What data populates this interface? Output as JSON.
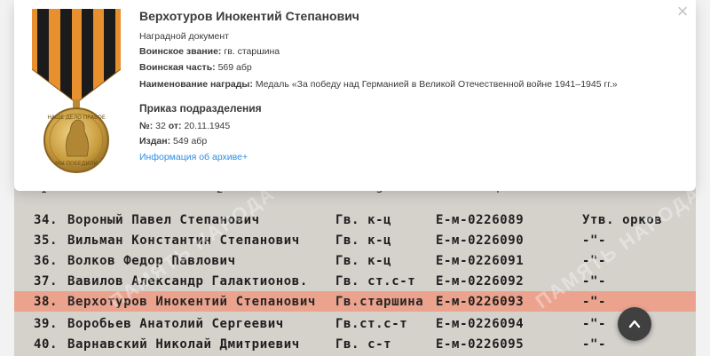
{
  "award": {
    "person_name": "Верхотуров Инокентий Степанович",
    "doc_type": "Наградной документ",
    "rank_label": "Воинское звание:",
    "rank_value": "гв. старшина",
    "unit_label": "Воинская часть:",
    "unit_value": "569 абр",
    "award_label": "Наименование награды:",
    "award_value": "Медаль «За победу над Германией в Великой Отечественной войне 1941–1945 гг.»"
  },
  "order": {
    "title": "Приказ подразделения",
    "number_label": "№:",
    "number_value": "32",
    "date_label": "от:",
    "date_value": "20.11.1945",
    "issued_label": "Издан:",
    "issued_value": "549 абр",
    "archive_link": "Информация об архиве+"
  },
  "medal_inscription_top": "НАШЕ ДЕЛО ПРАВОЕ",
  "medal_inscription_bottom": "МЫ ПОБЕДИЛИ",
  "scan": {
    "header_marks": [
      "I",
      "2",
      "3",
      "4"
    ],
    "rows": [
      {
        "num": "34.",
        "name": "Вороный Павел Степанович",
        "rank": "Гв. к-ц",
        "doc": "Е-м-0226089",
        "note": "Утв. орков"
      },
      {
        "num": "35.",
        "name": "Вильман Константин Степанович",
        "rank": "Гв. к-ц",
        "doc": "Е-м-0226090",
        "note": "-\"-"
      },
      {
        "num": "36.",
        "name": "Волков Федор Павлович",
        "rank": "Гв. к-ц",
        "doc": "Е-м-0226091",
        "note": "-\"-"
      },
      {
        "num": "37.",
        "name": "Вавилов Александр Галактионов.",
        "rank": "Гв. ст.с-т",
        "doc": "Е-м-0226092",
        "note": "-\"-"
      },
      {
        "num": "38.",
        "name": "Верхотуров Инокентий Степанович",
        "rank": "Гв.старшина",
        "doc": "Е-м-0226093",
        "note": "-\"-"
      },
      {
        "num": "39.",
        "name": "Воробьев Анатолий Сергеевич",
        "rank": "Гв.ст.с-т",
        "doc": "Е-м-0226094",
        "note": "-\"-"
      },
      {
        "num": "40.",
        "name": "Варнавский Николай Дмитриевич",
        "rank": "Гв. с-т",
        "doc": "Е-м-0226095",
        "note": "-\"-"
      }
    ],
    "watermark_left": "ПАМЯТЬ НАРОДА",
    "watermark_right": "ПАМЯТЬ НАРОДА"
  },
  "colors": {
    "link": "#2b8ee6",
    "highlight": "#eba38e",
    "ribbon_orange": "#e8902e",
    "ribbon_black": "#1b1b1b",
    "medal_gold": "#d8b35a"
  },
  "icons": {
    "close": "close-icon",
    "scroll_top": "chevron-up-icon"
  }
}
